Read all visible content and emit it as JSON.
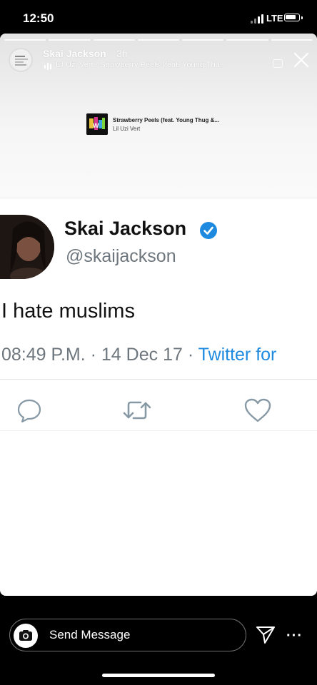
{
  "status_bar": {
    "time": "12:50",
    "network": "LTE"
  },
  "story": {
    "user": "Skai Jackson",
    "time_ago": "3h",
    "music": "Lil Uzi Vert · Strawberry Peels (feat. Young Thu...",
    "sticker": {
      "title": "Strawberry Peels (feat. Young Thug &...",
      "artist": "Lil Uzi Vert"
    }
  },
  "tweet": {
    "name": "Skai Jackson",
    "handle": "@skaijackson",
    "text": "I hate muslims",
    "time": "08:49 P.M.",
    "date": "14 Dec 17",
    "source": "Twitter for"
  },
  "reply_bar": {
    "placeholder": "Send Message",
    "more": "···"
  },
  "icons": [
    "music-bars-icon",
    "closed-caption-icon",
    "close-icon",
    "verified-badge-icon",
    "reply-icon",
    "retweet-icon",
    "like-icon",
    "camera-icon",
    "send-icon",
    "more-icon"
  ],
  "colors": {
    "twitter_blue": "#1d8ae0",
    "secondary_text": "#6e767d",
    "background": "#000000"
  }
}
